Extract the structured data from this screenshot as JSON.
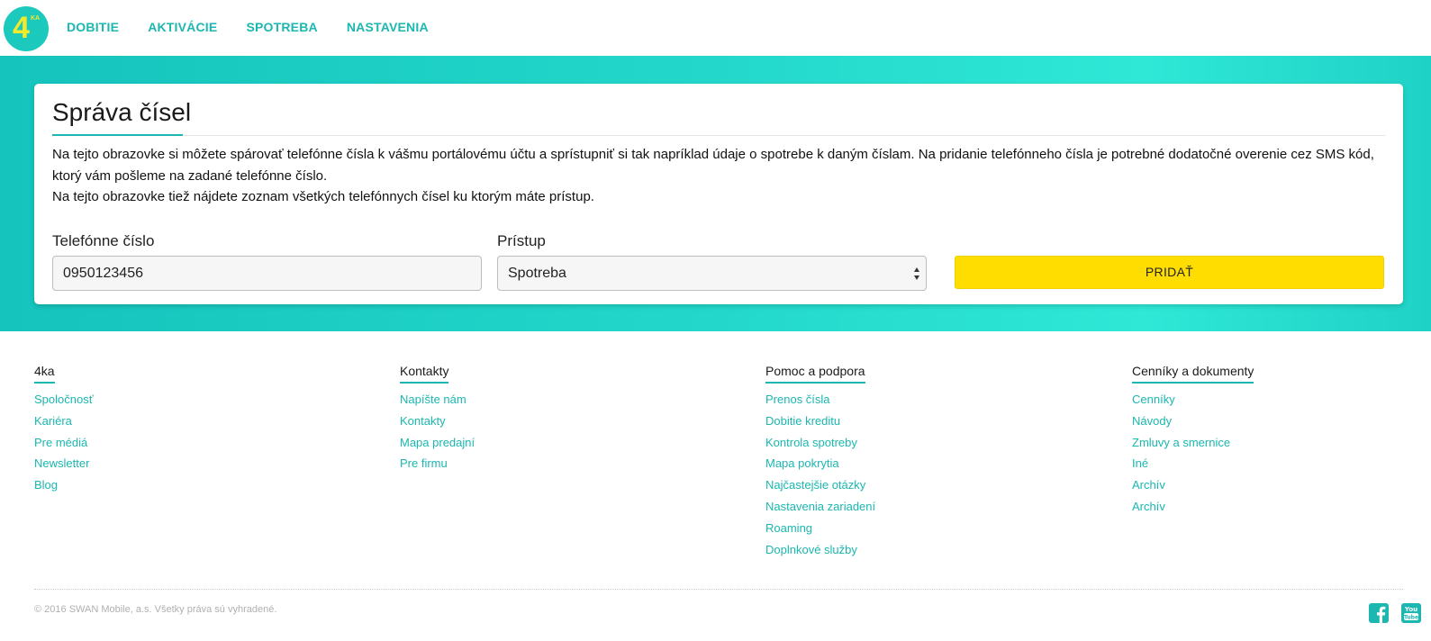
{
  "header": {
    "logo_text": "4",
    "logo_sub": "KA",
    "nav": [
      {
        "label": "DOBITIE"
      },
      {
        "label": "AKTIVÁCIE"
      },
      {
        "label": "SPOTREBA"
      },
      {
        "label": "NASTAVENIA"
      }
    ]
  },
  "main": {
    "title": "Správa čísel",
    "description_1": "Na tejto obrazovke si môžete spárovať telefónne čísla k vášmu portálovému účtu a sprístupniť si tak napríklad údaje o spotrebe k daným číslam. Na pridanie telefónneho čísla je potrebné dodatočné overenie cez SMS kód, ktorý vám pošleme na zadané telefónne číslo.",
    "description_2": "Na tejto obrazovke tiež nájdete zoznam všetkých telefónnych čísel ku ktorým máte prístup.",
    "phone_label": "Telefónne číslo",
    "phone_value": "0950123456",
    "access_label": "Prístup",
    "access_value": "Spotreba",
    "add_button": "PRIDAŤ"
  },
  "footer": {
    "columns": [
      {
        "heading": "4ka",
        "links": [
          "Spoločnosť",
          "Kariéra",
          "Pre médiá",
          "Newsletter",
          "Blog"
        ]
      },
      {
        "heading": "Kontakty",
        "links": [
          "Napíšte nám",
          "Kontakty",
          "Mapa predajní",
          "Pre firmu"
        ]
      },
      {
        "heading": "Pomoc a podpora",
        "links": [
          "Prenos čísla",
          "Dobitie kreditu",
          "Kontrola spotreby",
          "Mapa pokrytia",
          "Najčastejšie otázky",
          "Nastavenia zariadení",
          "Roaming",
          "Doplnkové služby"
        ]
      },
      {
        "heading": "Cenníky a dokumenty",
        "links": [
          "Cenníky",
          "Návody",
          "Zmluvy a smernice",
          "Iné",
          "Archív",
          "Archív"
        ]
      }
    ],
    "copyright": "© 2016 SWAN Mobile, a.s. Všetky práva sú vyhradené.",
    "social": [
      {
        "icon": "facebook-icon"
      },
      {
        "icon": "youtube-icon"
      }
    ],
    "accent_color": "#1bb7b0"
  },
  "colors": {
    "brand_teal": "#1cc9bd",
    "button_yellow": "#ffdd00",
    "logo_yellow": "#f2ea2a"
  }
}
